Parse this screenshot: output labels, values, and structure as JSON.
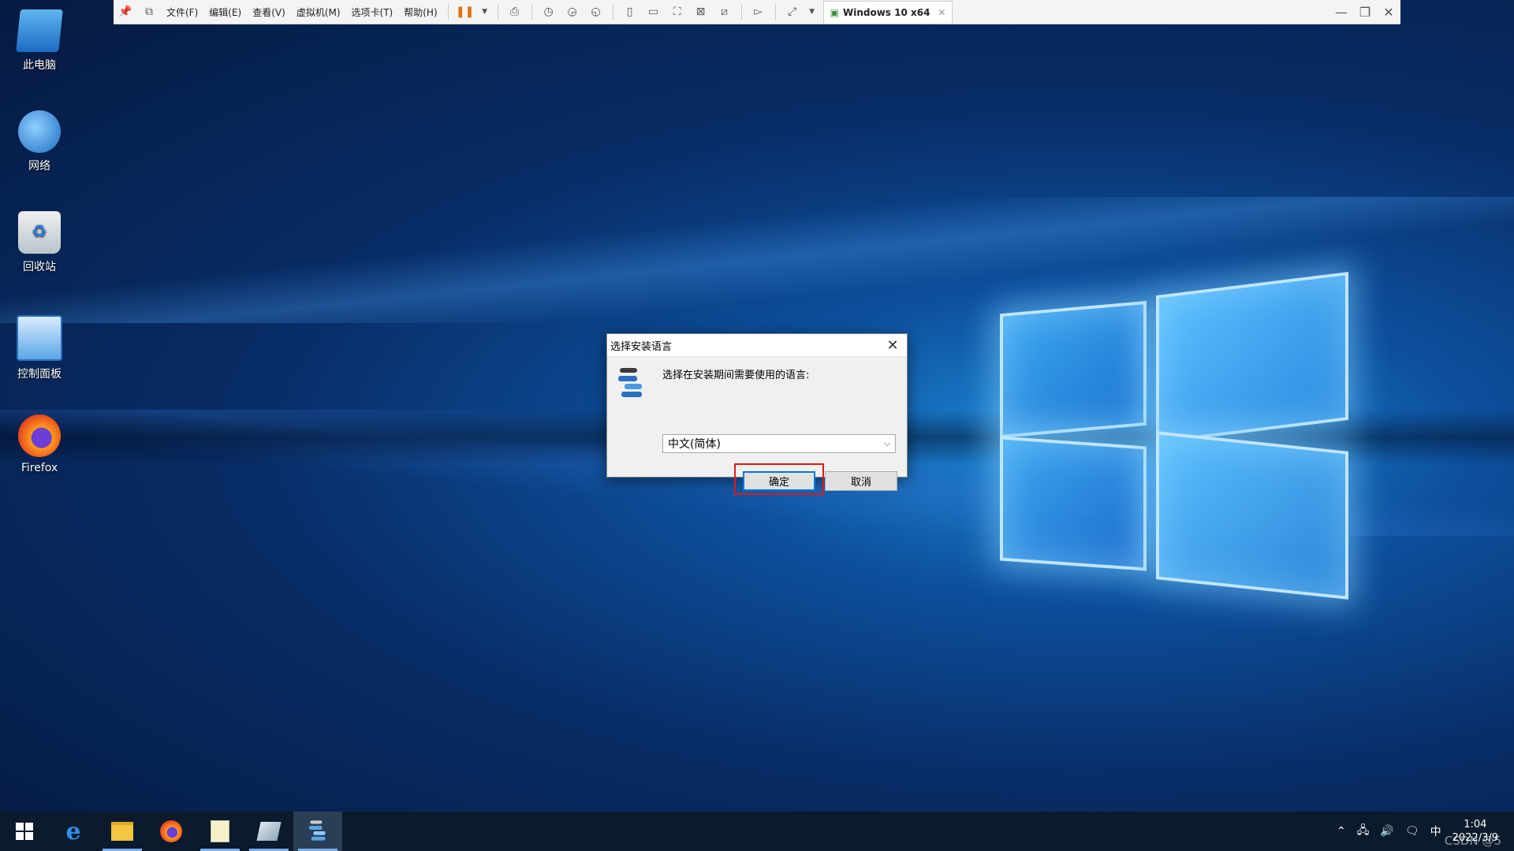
{
  "vm_toolbar": {
    "menus": [
      "文件(F)",
      "编辑(E)",
      "查看(V)",
      "虚拟机(M)",
      "选项卡(T)",
      "帮助(H)"
    ],
    "tab_label": "Windows 10 x64"
  },
  "desktop": {
    "icons": [
      {
        "label": "此电脑"
      },
      {
        "label": "网络"
      },
      {
        "label": "回收站"
      },
      {
        "label": "控制面板"
      },
      {
        "label": "Firefox"
      }
    ]
  },
  "dialog": {
    "title": "选择安装语言",
    "prompt": "选择在安装期间需要使用的语言:",
    "selected_language": "中文(简体)",
    "ok_label": "确定",
    "cancel_label": "取消"
  },
  "taskbar": {
    "apps": [
      "start-icon",
      "edge-icon",
      "file-explorer-icon",
      "firefox-icon",
      "notepad-icon",
      "installer-icon",
      "setup-icon"
    ],
    "ime": "中",
    "time": "1:04",
    "date": "2022/3/9",
    "watermark": "CSDN @5"
  },
  "colors": {
    "accent": "#0078d7",
    "highlight": "#e01818"
  }
}
